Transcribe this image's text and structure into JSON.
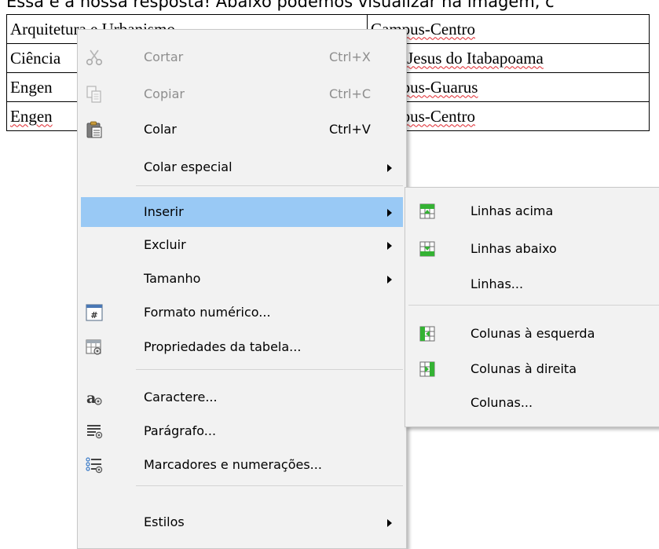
{
  "document": {
    "intro_line": "Essa é a nossa resposta! Abaixo podemos visualizar na imagem, c",
    "table_rows": [
      {
        "course": "Arquitetura e Urbanismo",
        "campus": "Campus-Centro"
      },
      {
        "course": "Ciência",
        "campus": "Bom Jesus do Itabapoama"
      },
      {
        "course": "Engen",
        "campus": "Campus-Guarus"
      },
      {
        "course": "Engen",
        "campus": "Campus-Centro"
      }
    ]
  },
  "context_menu": {
    "items": [
      {
        "label": "Cortar",
        "shortcut": "Ctrl+X",
        "icon": "scissors-icon",
        "enabled": false
      },
      {
        "label": "Copiar",
        "shortcut": "Ctrl+C",
        "icon": "copy-icon",
        "enabled": false
      },
      {
        "label": "Colar",
        "shortcut": "Ctrl+V",
        "icon": "paste-icon",
        "enabled": true
      },
      {
        "label": "Colar especial",
        "submenu": true
      },
      {
        "label": "Inserir",
        "submenu": true,
        "selected": true
      },
      {
        "label": "Excluir",
        "submenu": true
      },
      {
        "label": "Tamanho",
        "submenu": true
      },
      {
        "label": "Formato numérico...",
        "icon": "number-format-icon"
      },
      {
        "label": "Propriedades da tabela...",
        "icon": "table-properties-icon"
      },
      {
        "label": "Caractere...",
        "icon": "character-icon"
      },
      {
        "label": "Parágrafo...",
        "icon": "paragraph-icon"
      },
      {
        "label": "Marcadores e numerações...",
        "icon": "bullets-numbering-icon"
      },
      {
        "label": "Estilos",
        "submenu": true
      }
    ]
  },
  "insert_submenu": {
    "items": [
      {
        "label": "Linhas acima",
        "icon": "insert-rows-above-icon"
      },
      {
        "label": "Linhas abaixo",
        "icon": "insert-rows-below-icon"
      },
      {
        "label": "Linhas..."
      },
      {
        "label": "Colunas à esquerda",
        "icon": "insert-columns-left-icon"
      },
      {
        "label": "Colunas à direita",
        "icon": "insert-columns-right-icon"
      },
      {
        "label": "Colunas..."
      }
    ]
  },
  "colors": {
    "menu_background": "#f2f2f2",
    "selection_highlight": "#99c9f5",
    "disabled_text": "#8e8e8e",
    "spellcheck_underline": "#e0262c",
    "table_icon_green": "#34b233"
  }
}
